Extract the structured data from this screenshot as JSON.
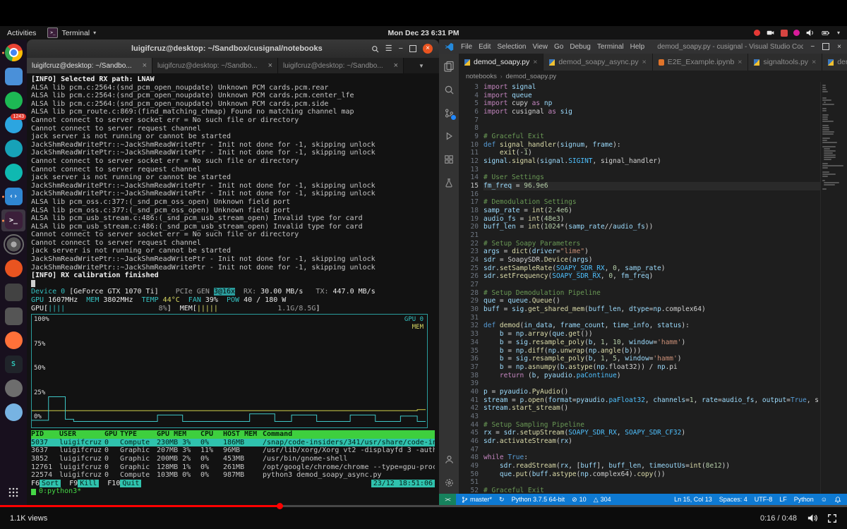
{
  "player": {
    "views": "1.1K views",
    "time": "0:16 / 0:48",
    "progress_pct": 33,
    "accent": "#ff0000"
  },
  "panel": {
    "activities": "Activities",
    "app_menu": "Terminal",
    "clock": "Mon Dec 23  6:31 PM",
    "tray": [
      "record",
      "camera",
      "app-red",
      "app-pink",
      "volume",
      "battery",
      "caret"
    ]
  },
  "dock": {
    "items": [
      {
        "name": "chrome",
        "cls": "chrome",
        "running": true
      },
      {
        "name": "files",
        "color": "#4a90d9",
        "shape": "square"
      },
      {
        "name": "spotify",
        "color": "#1db954",
        "shape": "circle"
      },
      {
        "name": "telegram",
        "color": "#2ca5e0",
        "shape": "circle",
        "badge": "1243"
      },
      {
        "name": "mail",
        "color": "#17a2b8",
        "shape": "circle"
      },
      {
        "name": "music-teal",
        "color": "#0fb9b1",
        "shape": "circle"
      },
      {
        "name": "vscode",
        "color": "#2f86d2",
        "shape": "square",
        "glyph": "‹›",
        "running": true
      },
      {
        "name": "terminal",
        "color": "#3b1f3a",
        "shape": "square",
        "glyph": ">_",
        "running": true,
        "active": true
      },
      {
        "name": "settings",
        "cls": "gear",
        "shape": "circle"
      },
      {
        "name": "ubuntu-orange",
        "color": "#e95420",
        "shape": "circle"
      },
      {
        "name": "app-box",
        "color": "#424242",
        "shape": "square"
      },
      {
        "name": "app-cube",
        "color": "#555555",
        "shape": "square"
      },
      {
        "name": "firefox",
        "color": "#ff7139",
        "shape": "circle"
      },
      {
        "name": "app-s",
        "color": "#20242a",
        "shape": "square",
        "glyph": "S",
        "glyphColor": "#2ec4b6"
      },
      {
        "name": "screenshot",
        "color": "#6d6d6d",
        "shape": "circle"
      },
      {
        "name": "chromium",
        "color": "#77b3e2",
        "shape": "circle"
      }
    ]
  },
  "terminal": {
    "title": "luigifcruz@desktop: ~/Sandbox/cusignal/notebooks",
    "active_tab": 0,
    "tabs": [
      "luigifcruz@desktop: ~/Sandbo...",
      "luigifcruz@desktop: ~/Sandbo...",
      "luigifcruz@desktop: ~/Sandbo..."
    ],
    "log_lines": [
      "[INFO] Selected RX path: LNAW",
      "ALSA lib pcm.c:2564:(snd_pcm_open_noupdate) Unknown PCM cards.pcm.rear",
      "ALSA lib pcm.c:2564:(snd_pcm_open_noupdate) Unknown PCM cards.pcm.center_lfe",
      "ALSA lib pcm.c:2564:(snd_pcm_open_noupdate) Unknown PCM cards.pcm.side",
      "ALSA lib pcm_route.c:869:(find_matching_chmap) Found no matching channel map",
      "Cannot connect to server socket err = No such file or directory",
      "Cannot connect to server request channel",
      "jack server is not running or cannot be started",
      "JackShmReadWritePtr::~JackShmReadWritePtr - Init not done for -1, skipping unlock",
      "JackShmReadWritePtr::~JackShmReadWritePtr - Init not done for -1, skipping unlock",
      "Cannot connect to server socket err = No such file or directory",
      "Cannot connect to server request channel",
      "jack server is not running or cannot be started",
      "JackShmReadWritePtr::~JackShmReadWritePtr - Init not done for -1, skipping unlock",
      "JackShmReadWritePtr::~JackShmReadWritePtr - Init not done for -1, skipping unlock",
      "ALSA lib pcm_oss.c:377:(_snd_pcm_oss_open) Unknown field port",
      "ALSA lib pcm_oss.c:377:(_snd_pcm_oss_open) Unknown field port",
      "ALSA lib pcm_usb_stream.c:486:(_snd_pcm_usb_stream_open) Invalid type for card",
      "ALSA lib pcm_usb_stream.c:486:(_snd_pcm_usb_stream_open) Invalid type for card",
      "Cannot connect to server socket err = No such file or directory",
      "Cannot connect to server request channel",
      "jack server is not running or cannot be started",
      "JackShmReadWritePtr::~JackShmReadWritePtr - Init not done for -1, skipping unlock",
      "JackShmReadWritePtr::~JackShmReadWritePtr - Init not done for -1, skipping unlock",
      "[INFO] RX calibration finished"
    ],
    "nvtop": {
      "lines": [
        [
          [
            "Device 0 ",
            "cy"
          ],
          [
            "[GeForce GTX 1070 Ti]",
            "wh"
          ],
          [
            "    PCIe GEN ",
            "gr"
          ],
          [
            "3@16x",
            "inv"
          ],
          [
            "  RX: ",
            "gr"
          ],
          [
            "30.00 MB/s",
            "wh"
          ],
          [
            "   TX: ",
            "gr"
          ],
          [
            "447.0 MB/s",
            "wh"
          ]
        ],
        [
          [
            "GPU ",
            "cy"
          ],
          [
            "1607MHz  ",
            "wh"
          ],
          [
            "MEM ",
            "cy"
          ],
          [
            "3802MHz  ",
            "wh"
          ],
          [
            "TEMP ",
            "cy"
          ],
          [
            "44°C  ",
            "yl"
          ],
          [
            "FAN ",
            "cy"
          ],
          [
            "39%  ",
            "wh"
          ],
          [
            "POW ",
            "cy"
          ],
          [
            "40 / 180 W",
            "wh"
          ]
        ],
        [
          [
            "GPU[",
            "wh"
          ],
          [
            "||||",
            "cy"
          ],
          [
            "                      8%",
            "gr"
          ],
          [
            "]",
            "wh"
          ],
          [
            "  MEM[",
            "wh"
          ],
          [
            "|||||",
            "yl"
          ],
          [
            "              1.1G/8.5G",
            "gr"
          ],
          [
            "]",
            "wh"
          ]
        ]
      ],
      "graph": {
        "legend": [
          "GPU 0",
          "MEM"
        ],
        "y_labels": [
          "100%",
          "75%",
          "50%",
          "25%",
          "0%"
        ],
        "gpu_color": "#3ec6c6",
        "mem_color": "#cfcf4a",
        "gpu_pct": [
          4,
          4,
          26,
          26,
          5,
          3,
          3,
          3,
          3,
          3,
          3,
          3,
          3,
          3,
          3,
          9,
          9,
          9,
          3,
          3,
          3,
          3,
          3,
          3,
          3,
          3,
          10,
          10,
          10,
          3,
          3,
          9,
          9,
          9,
          3,
          3,
          3,
          3,
          9,
          9,
          9,
          3,
          3,
          3,
          8,
          8,
          3,
          3
        ],
        "mem_pct": [
          13,
          13,
          13,
          13,
          13,
          13,
          13,
          13,
          13,
          13,
          13,
          13,
          13,
          13,
          13,
          13,
          13,
          13,
          13,
          13,
          13,
          13,
          13,
          13,
          13,
          13,
          13,
          13,
          13,
          13,
          13,
          13,
          13,
          13,
          13,
          13,
          13,
          13,
          13,
          13,
          13,
          13,
          13,
          13,
          13,
          13,
          14,
          14
        ]
      },
      "table": {
        "headers": [
          "PID",
          "USER",
          "GPU",
          "TYPE",
          "GPU MEM",
          "CPU",
          "HOST MEM",
          "Command"
        ],
        "selected_row": 0,
        "rows": [
          [
            "5037",
            "luigifcruz",
            "0",
            "Compute",
            "230MB 3%",
            "0%",
            "186MB",
            "/snap/code-insiders/341/usr/share/code-in"
          ],
          [
            "3637",
            "luigifcruz",
            "0",
            "Graphic",
            "207MB 3%",
            "11%",
            "96MB",
            "/usr/lib/xorg/Xorg vt2 -displayfd 3 -auth"
          ],
          [
            "3852",
            "luigifcruz",
            "0",
            "Graphic",
            "200MB 2%",
            "0%",
            "453MB",
            "/usr/bin/gnome-shell"
          ],
          [
            "12761",
            "luigifcruz",
            "0",
            "Graphic",
            "128MB 1%",
            "0%",
            "261MB",
            "/opt/google/chrome/chrome --type=gpu-proc"
          ],
          [
            "22574",
            "luigifcruz",
            "0",
            "Compute",
            "103MB 0%",
            "0%",
            "987MB",
            "python3 demod_soapy_async.py"
          ]
        ]
      },
      "fkeys": [
        [
          "F6",
          "Sort"
        ],
        [
          "F9",
          "Kill"
        ],
        [
          "F10",
          "Quit"
        ]
      ],
      "datetime": "23/12  18:51:06",
      "tmux": "0:python3*"
    }
  },
  "vscode": {
    "title": "demod_soapy.py - cusignal - Visual Studio Code - Insid...",
    "menus": [
      "File",
      "Edit",
      "Selection",
      "View",
      "Go",
      "Debug",
      "Terminal",
      "Help"
    ],
    "tabs": [
      {
        "label": "demod_soapy.py",
        "active": true
      },
      {
        "label": "demod_soapy_async.py"
      },
      {
        "label": "E2E_Example.ipynb",
        "kind": "ipynb"
      },
      {
        "label": "signaltools.py"
      },
      {
        "label": "dem",
        "truncated": true
      }
    ],
    "breadcrumbs": [
      "notebooks",
      "demod_soapy.py"
    ],
    "activity_top": [
      {
        "name": "explorer"
      },
      {
        "name": "search"
      },
      {
        "name": "source-control",
        "badge": true
      },
      {
        "name": "run-debug"
      },
      {
        "name": "extensions"
      },
      {
        "name": "testing"
      }
    ],
    "activity_bottom": [
      {
        "name": "account"
      },
      {
        "name": "settings-gear"
      }
    ],
    "code": {
      "first_line": 3,
      "current_line": 15,
      "lines": [
        "import signal",
        "import queue",
        "import cupy as np",
        "import cusignal as sig",
        "",
        "",
        "# Graceful Exit",
        "def signal_handler(signum, frame):",
        "    exit(-1)",
        "signal.signal(signal.SIGINT, signal_handler)",
        "",
        "# User Settings",
        "fm_freq = 96.9e6",
        "",
        "# Demodulation Settings",
        "samp_rate = int(2.4e6)",
        "audio_fs = int(48e3)",
        "buff_len = int(1024*(samp_rate//audio_fs))",
        "",
        "# Setup Soapy Parameters",
        "args = dict(driver=\"lime\")",
        "sdr = SoapySDR.Device(args)",
        "sdr.setSampleRate(SOAPY_SDR_RX, 0, samp_rate)",
        "sdr.setFrequency(SOAPY_SDR_RX, 0, fm_freq)",
        "",
        "# Setup Demodulation Pipeline",
        "que = queue.Queue()",
        "buff = sig.get_shared_mem(buff_len, dtype=np.complex64)",
        "",
        "def demod(in_data, frame_count, time_info, status):",
        "    b = np.array(que.get())",
        "    b = sig.resample_poly(b, 1, 10, window='hamm')",
        "    b = np.diff(np.unwrap(np.angle(b)))",
        "    b = sig.resample_poly(b, 1, 5, window='hamm')",
        "    b = np.asnumpy(b.astype(np.float32)) / np.pi",
        "    return (b, pyaudio.paContinue)",
        "",
        "p = pyaudio.PyAudio()",
        "stream = p.open(format=pyaudio.paFloat32, channels=1, rate=audio_fs, output=True, s",
        "stream.start_stream()",
        "",
        "# Setup Sampling Pipeline",
        "rx = sdr.setupStream(SOAPY_SDR_RX, SOAPY_SDR_CF32)",
        "sdr.activateStream(rx)",
        "",
        "while True:",
        "    sdr.readStream(rx, [buff], buff_len, timeoutUs=int(8e12))",
        "    que.put(buff.astype(np.complex64).copy())",
        "",
        "# Graceful Exit"
      ]
    },
    "status": {
      "remote": "><",
      "left": [
        {
          "name": "git-branch",
          "icon": "branch",
          "text": "master*"
        },
        {
          "name": "sync",
          "icon": "sync",
          "text": ""
        },
        {
          "name": "python-interpreter",
          "text": "Python 3.7.5 64-bit"
        },
        {
          "name": "errors",
          "icon": "error",
          "text": "10"
        },
        {
          "name": "warnings",
          "icon": "warning",
          "text": "304"
        }
      ],
      "right": [
        {
          "name": "cursor-position",
          "text": "Ln 15, Col 13"
        },
        {
          "name": "indentation",
          "text": "Spaces: 4"
        },
        {
          "name": "encoding",
          "text": "UTF-8"
        },
        {
          "name": "eol",
          "text": "LF"
        },
        {
          "name": "language-mode",
          "text": "Python"
        },
        {
          "name": "feedback",
          "icon": "feedback",
          "text": ""
        },
        {
          "name": "notifications",
          "icon": "bell",
          "text": ""
        }
      ]
    }
  }
}
